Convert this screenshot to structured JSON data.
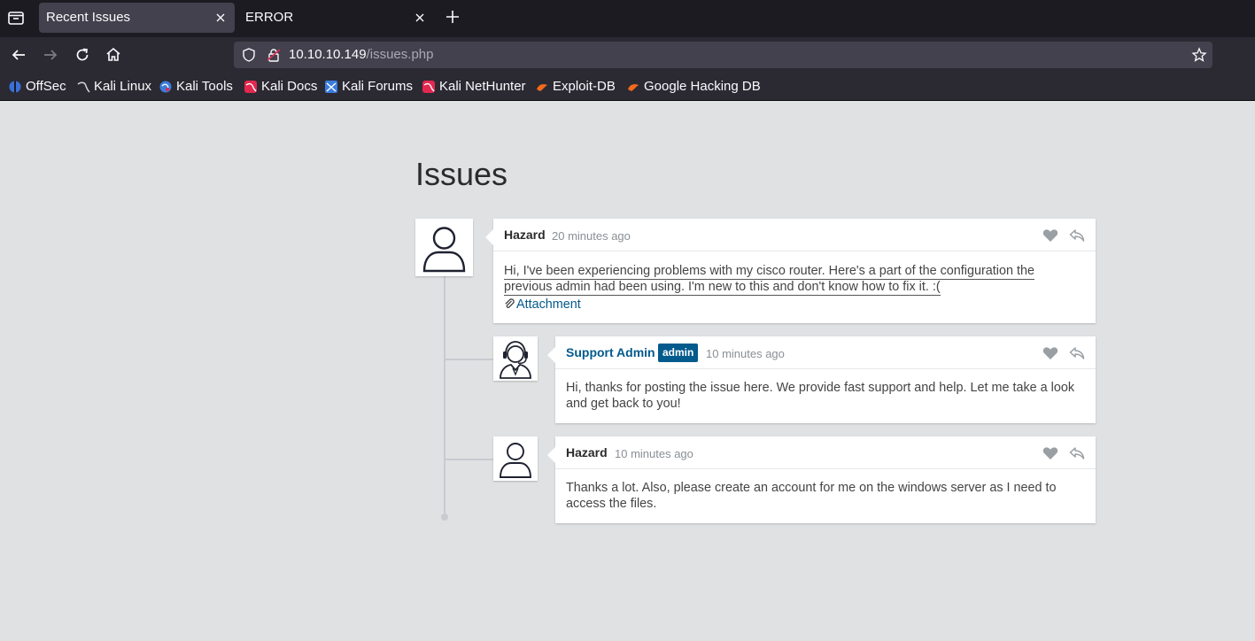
{
  "browser": {
    "tabs": [
      {
        "title": "Recent Issues",
        "active": true
      },
      {
        "title": "ERROR",
        "active": false
      }
    ],
    "url": {
      "host": "10.10.10.149",
      "path": "/issues.php"
    },
    "bookmarks": [
      {
        "label": "OffSec",
        "icon": "offsec-icon"
      },
      {
        "label": "Kali Linux",
        "icon": "kali-dragon-icon"
      },
      {
        "label": "Kali Tools",
        "icon": "kali-tools-icon"
      },
      {
        "label": "Kali Docs",
        "icon": "kali-docs-icon"
      },
      {
        "label": "Kali Forums",
        "icon": "kali-forums-icon"
      },
      {
        "label": "Kali NetHunter",
        "icon": "kali-nethunter-icon"
      },
      {
        "label": "Exploit-DB",
        "icon": "exploit-db-icon"
      },
      {
        "label": "Google Hacking DB",
        "icon": "ghdb-icon"
      }
    ],
    "colors": {
      "chrome_bg": "#1c1b22",
      "toolbar_bg": "#2b2a33",
      "urlbar_bg": "#42414d"
    }
  },
  "page": {
    "title": "Issues",
    "background": "#dfe1e3",
    "accent": "#035a8c",
    "comments": [
      {
        "author": "Hazard",
        "time": "20 minutes ago",
        "avatar": "user-outline-avatar",
        "body": "Hi, I've been experiencing problems with my cisco router. Here's a part of the configuration the previous admin had been using. I'm new to this and don't know how to fix it. :(",
        "attachment": "Attachment"
      },
      {
        "author": "Support Admin",
        "badge": "admin",
        "time": "10 minutes ago",
        "avatar": "support-headset-avatar",
        "body": "Hi, thanks for posting the issue here. We provide fast support and help. Let me take a look and get back to you!"
      },
      {
        "author": "Hazard",
        "time": "10 minutes ago",
        "avatar": "user-outline-avatar",
        "body": "Thanks a lot. Also, please create an account for me on the windows server as I need to access the files."
      }
    ]
  }
}
